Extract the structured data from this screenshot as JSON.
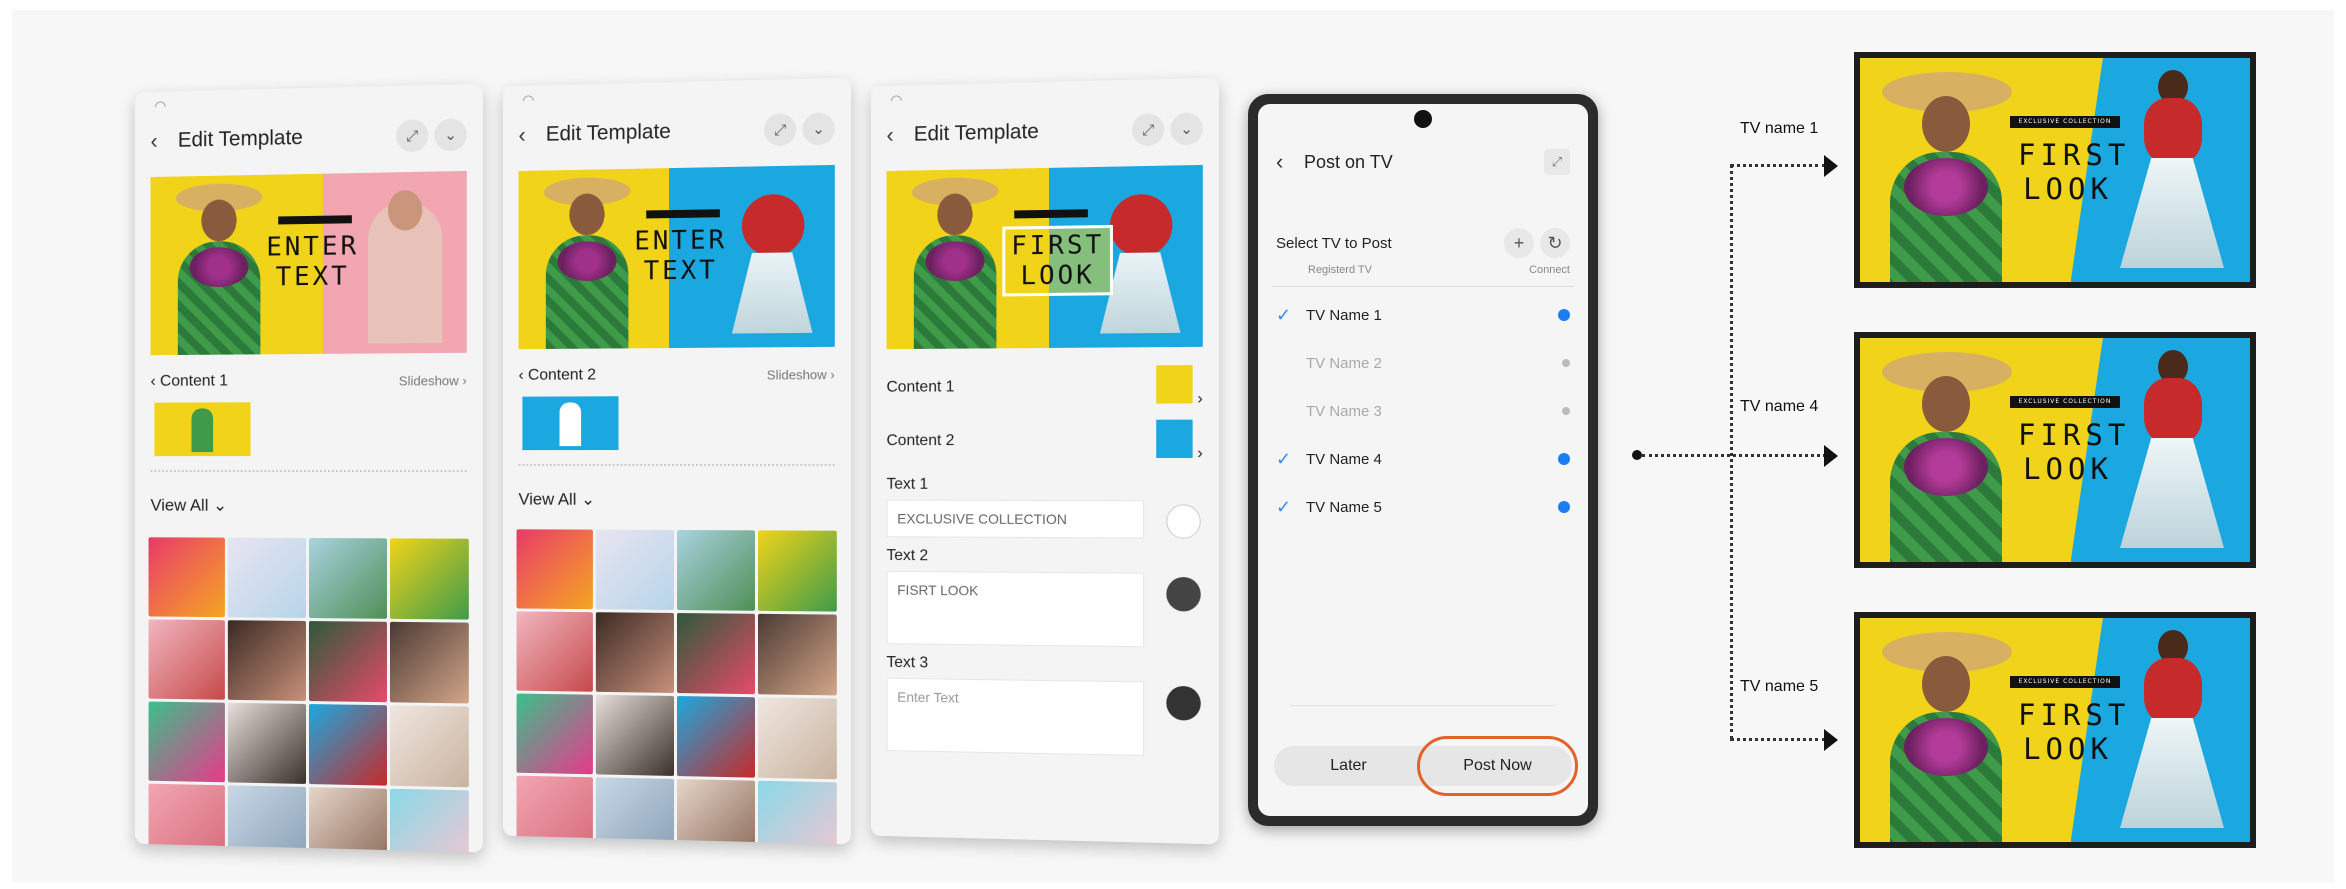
{
  "screen1": {
    "title": "Edit Template",
    "preview_text": "ENTER\nTEXT",
    "content_label": "Content 1",
    "slideshow": "Slideshow",
    "view_all": "View All"
  },
  "screen2": {
    "title": "Edit Template",
    "preview_text": "ENTER\nTEXT",
    "content_label": "Content 2",
    "slideshow": "Slideshow",
    "view_all": "View All"
  },
  "screen3": {
    "title": "Edit Template",
    "preview_text": "FIRST\nLOOK",
    "content1": "Content 1",
    "content2": "Content 2",
    "text1_label": "Text 1",
    "text1_value": "EXCLUSIVE COLLECTION",
    "text2_label": "Text 2",
    "text2_value": "FISRT LOOK",
    "text3_label": "Text 3",
    "text3_placeholder": "Enter Text"
  },
  "phone": {
    "title": "Post on TV",
    "select_title": "Select TV to Post",
    "registered_tv": "Registerd TV",
    "connect": "Connect",
    "tvs": [
      {
        "name": "TV Name 1",
        "checked": true,
        "connected": true
      },
      {
        "name": "TV Name 2",
        "checked": false,
        "connected": false
      },
      {
        "name": "TV Name 3",
        "checked": false,
        "connected": false
      },
      {
        "name": "TV Name 4",
        "checked": true,
        "connected": true
      },
      {
        "name": "TV Name 5",
        "checked": true,
        "connected": true
      }
    ],
    "later_label": "Later",
    "post_now_label": "Post Now"
  },
  "targets": [
    {
      "label": "TV name 1",
      "banner": "EXCLUSIVE COLLECTION",
      "headline": "FIRST\nLOOK"
    },
    {
      "label": "TV name 4",
      "banner": "EXCLUSIVE COLLECTION",
      "headline": "FIRST\nLOOK"
    },
    {
      "label": "TV name 5",
      "banner": "EXCLUSIVE COLLECTION",
      "headline": "FIRST\nLOOK"
    }
  ],
  "colors": {
    "accent_blue": "#1a7ef0",
    "highlight_orange": "#e2622a",
    "template_yellow": "#f1d41a",
    "template_blue": "#1ba8e0"
  }
}
